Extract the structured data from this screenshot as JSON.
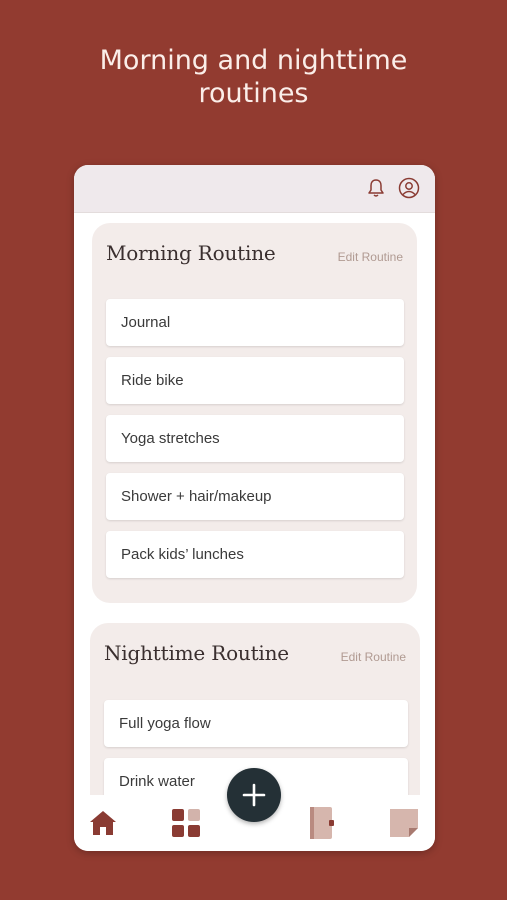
{
  "headline": {
    "line1": "Morning and nighttime",
    "line2": "routines"
  },
  "topbar": {
    "icons": [
      "bell-icon",
      "profile-icon"
    ]
  },
  "morning": {
    "title": "Morning Routine",
    "edit_label": "Edit Routine",
    "tasks": [
      "Journal",
      "Ride bike",
      "Yoga stretches",
      "Shower + hair/makeup",
      "Pack kids’ lunches"
    ]
  },
  "night": {
    "title": "Nighttime Routine",
    "edit_label": "Edit Routine",
    "tasks": [
      "Full yoga flow",
      "Drink water"
    ]
  },
  "bottom_nav": {
    "items": [
      "home-icon",
      "grid-icon",
      "add-icon",
      "journal-icon",
      "notes-icon"
    ]
  },
  "colors": {
    "background": "#923b30",
    "accent": "#8a3b33",
    "fab": "#243036",
    "card": "#f3ecea"
  }
}
